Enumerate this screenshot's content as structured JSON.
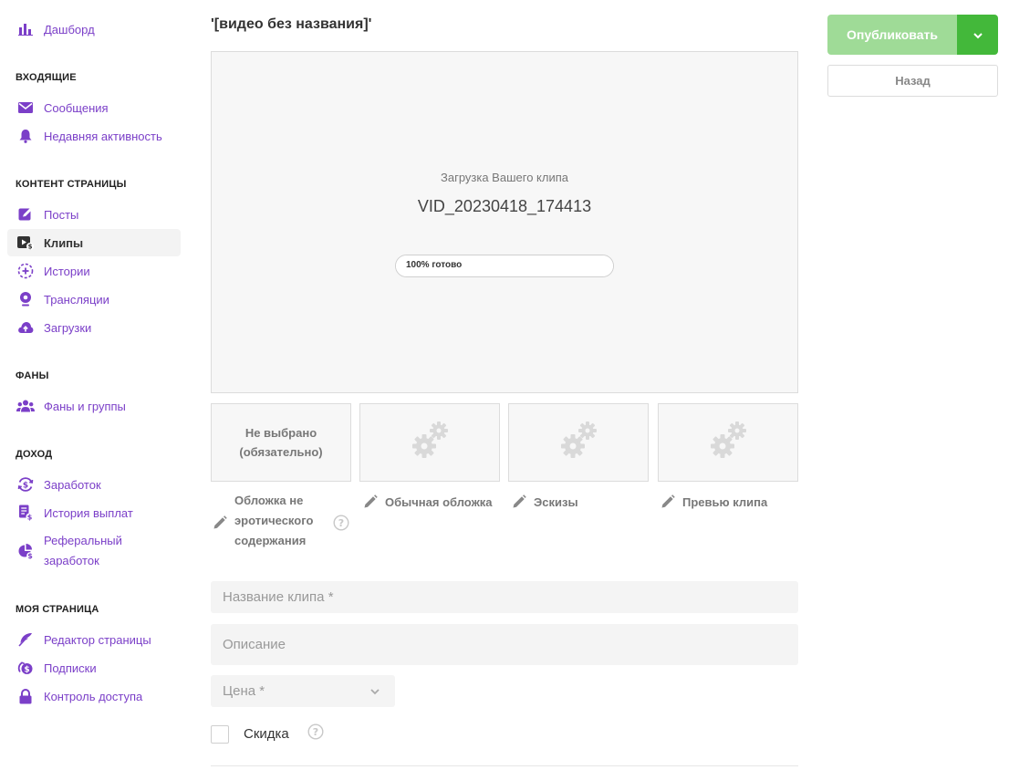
{
  "sidebar": {
    "top_item": {
      "label": "Дашборд",
      "icon": "bar-chart-icon"
    },
    "sections": [
      {
        "title": "ВХОДЯЩИЕ",
        "items": [
          {
            "label": "Сообщения",
            "icon": "envelope-icon"
          },
          {
            "label": "Недавняя активность",
            "icon": "bell-icon"
          }
        ]
      },
      {
        "title": "КОНТЕНТ СТРАНИЦЫ",
        "items": [
          {
            "label": "Посты",
            "icon": "edit-icon"
          },
          {
            "label": "Клипы",
            "icon": "clip-icon",
            "active": true
          },
          {
            "label": "Истории",
            "icon": "story-icon"
          },
          {
            "label": "Трансляции",
            "icon": "webcam-icon"
          },
          {
            "label": "Загрузки",
            "icon": "cloud-upload-icon"
          }
        ]
      },
      {
        "title": "ФАНЫ",
        "items": [
          {
            "label": "Фаны и группы",
            "icon": "users-icon"
          }
        ]
      },
      {
        "title": "ДОХОД",
        "items": [
          {
            "label": "Заработок",
            "icon": "dollar-cycle-icon"
          },
          {
            "label": "История выплат",
            "icon": "payout-history-icon"
          },
          {
            "label_line1": "Реферальный",
            "label_line2": "заработок",
            "icon": "pie-chart-icon"
          }
        ]
      },
      {
        "title": "МОЯ СТРАНИЦА",
        "items": [
          {
            "label": "Редактор страницы",
            "icon": "feather-icon"
          },
          {
            "label": "Подписки",
            "icon": "subscription-icon"
          },
          {
            "label": "Контроль доступа",
            "icon": "lock-icon"
          }
        ]
      }
    ]
  },
  "main": {
    "title": "'[видео без названия]'",
    "upload": {
      "caption": "Загрузка Вашего клипа",
      "filename": "VID_20230418_174413",
      "progress_text": "100% готово",
      "progress_percent": 100
    },
    "thumbs": {
      "first_line1": "Не выбрано",
      "first_line2": "(обязательно)",
      "labels": {
        "nonerotic_line1": "Обложка не",
        "nonerotic_line2": "эротического",
        "nonerotic_line3": "содержания",
        "regular": "Обычная обложка",
        "sketches": "Эскизы",
        "preview": "Превью клипа"
      }
    },
    "form": {
      "title_placeholder": "Название клипа *",
      "description_placeholder": "Описание",
      "price_placeholder": "Цена *",
      "discount_label": "Скидка"
    }
  },
  "actions": {
    "publish_label": "Опубликовать",
    "back_label": "Назад"
  },
  "colors": {
    "accent_purple": "#7b3fc8",
    "publish_green_light": "#9fdb97",
    "publish_green": "#43b83a"
  }
}
